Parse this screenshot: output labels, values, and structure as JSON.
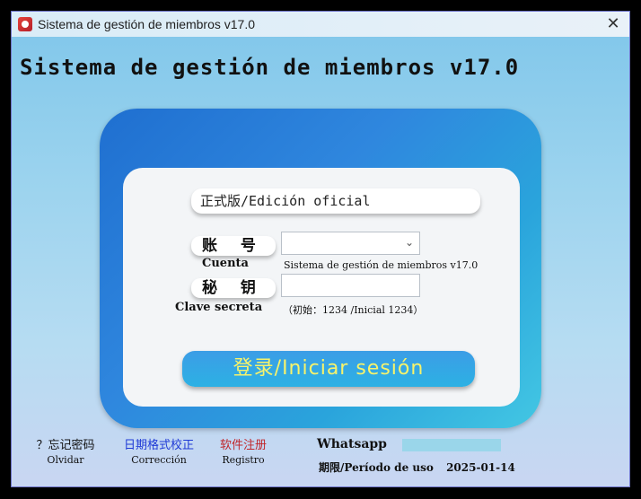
{
  "window": {
    "title": "Sistema de gestión de miembros v17.0",
    "close_glyph": "✕"
  },
  "header": {
    "title": "Sistema de gestión de miembros v17.0"
  },
  "login": {
    "edition": "正式版/Edición oficial",
    "account_label": "账 号",
    "account_label_es": "Cuenta",
    "account_value": "",
    "account_hint": "Sistema de gestión de miembros v17.0",
    "password_label": "秘 钥",
    "password_label_es": "Clave secreta",
    "password_hint": "（初始：1234 /Inicial 1234）",
    "login_button": "登录/Iniciar sesión"
  },
  "footer": {
    "forgot": {
      "top": "？忘记密码",
      "bottom": "Olvidar",
      "color": "#111111"
    },
    "correct": {
      "top": "日期格式校正",
      "bottom": "Corrección",
      "color": "#1f3ad6"
    },
    "register": {
      "top": "软件注册",
      "bottom": "Registro",
      "color": "#c0262b"
    },
    "whatsapp_label": "Whatsapp",
    "expiry_label": "期限/Período de uso",
    "expiry_date": "2025-01-14"
  },
  "colors": {
    "blue_card": "#2f87de",
    "login_text": "#f7f36b"
  }
}
